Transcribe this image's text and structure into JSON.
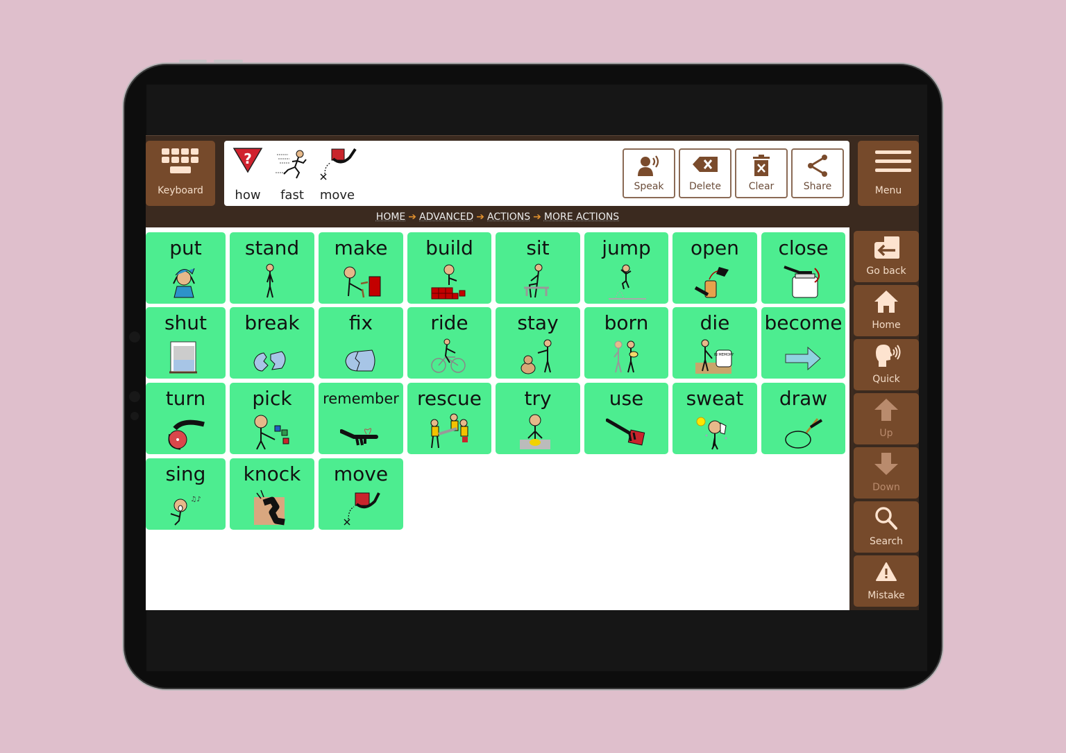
{
  "app": {
    "keyboard_label": "Keyboard",
    "menu_label": "Menu",
    "sentence": [
      {
        "label": "how",
        "icon": "question-triangle-icon"
      },
      {
        "label": "fast",
        "icon": "running-person-icon"
      },
      {
        "label": "move",
        "icon": "move-box-icon"
      }
    ],
    "actions": [
      {
        "label": "Speak",
        "icon": "speak-icon"
      },
      {
        "label": "Delete",
        "icon": "backspace-icon"
      },
      {
        "label": "Clear",
        "icon": "trash-icon"
      },
      {
        "label": "Share",
        "icon": "share-icon"
      }
    ],
    "breadcrumb": [
      "HOME",
      "ADVANCED",
      "ACTIONS",
      "MORE ACTIONS"
    ],
    "breadcrumb_separator": "➔",
    "grid": [
      {
        "label": "put",
        "icon": "put-on-hat-icon"
      },
      {
        "label": "stand",
        "icon": "standing-person-icon"
      },
      {
        "label": "make",
        "icon": "hammer-person-icon"
      },
      {
        "label": "build",
        "icon": "building-blocks-icon"
      },
      {
        "label": "sit",
        "icon": "sitting-person-icon"
      },
      {
        "label": "jump",
        "icon": "jumping-person-icon"
      },
      {
        "label": "open",
        "icon": "open-jar-icon"
      },
      {
        "label": "close",
        "icon": "close-jar-icon"
      },
      {
        "label": "shut",
        "icon": "shutter-icon"
      },
      {
        "label": "break",
        "icon": "broken-vase-icon"
      },
      {
        "label": "fix",
        "icon": "fixed-vase-icon"
      },
      {
        "label": "ride",
        "icon": "bicycle-icon"
      },
      {
        "label": "stay",
        "icon": "stay-dog-icon"
      },
      {
        "label": "born",
        "icon": "born-baby-icon"
      },
      {
        "label": "die",
        "icon": "grave-icon"
      },
      {
        "label": "become",
        "icon": "arrow-right-icon"
      },
      {
        "label": "turn",
        "icon": "turn-knob-icon"
      },
      {
        "label": "pick",
        "icon": "pick-blocks-icon"
      },
      {
        "label": "remember",
        "icon": "finger-bow-icon"
      },
      {
        "label": "rescue",
        "icon": "rescue-team-icon"
      },
      {
        "label": "try",
        "icon": "try-person-icon"
      },
      {
        "label": "use",
        "icon": "use-hand-icon"
      },
      {
        "label": "sweat",
        "icon": "sweat-sun-icon"
      },
      {
        "label": "draw",
        "icon": "pencil-draw-icon"
      },
      {
        "label": "sing",
        "icon": "singing-person-icon"
      },
      {
        "label": "knock",
        "icon": "knocking-fist-icon"
      },
      {
        "label": "move",
        "icon": "move-box-icon"
      }
    ],
    "side_nav": [
      {
        "label": "Go back",
        "icon": "go-back-icon",
        "enabled": true
      },
      {
        "label": "Home",
        "icon": "home-icon",
        "enabled": true
      },
      {
        "label": "Quick",
        "icon": "quick-speak-icon",
        "enabled": true
      },
      {
        "label": "Up",
        "icon": "arrow-up-icon",
        "enabled": false
      },
      {
        "label": "Down",
        "icon": "arrow-down-icon",
        "enabled": false
      },
      {
        "label": "Search",
        "icon": "search-icon",
        "enabled": true
      },
      {
        "label": "Mistake",
        "icon": "warning-icon",
        "enabled": true
      }
    ],
    "colors": {
      "cell_green": "#4ded90",
      "button_brown": "#764a2b",
      "header_dark": "#3b2a1f",
      "accent_orange": "#e2912e",
      "background_pink": "#dfbfcc"
    }
  }
}
